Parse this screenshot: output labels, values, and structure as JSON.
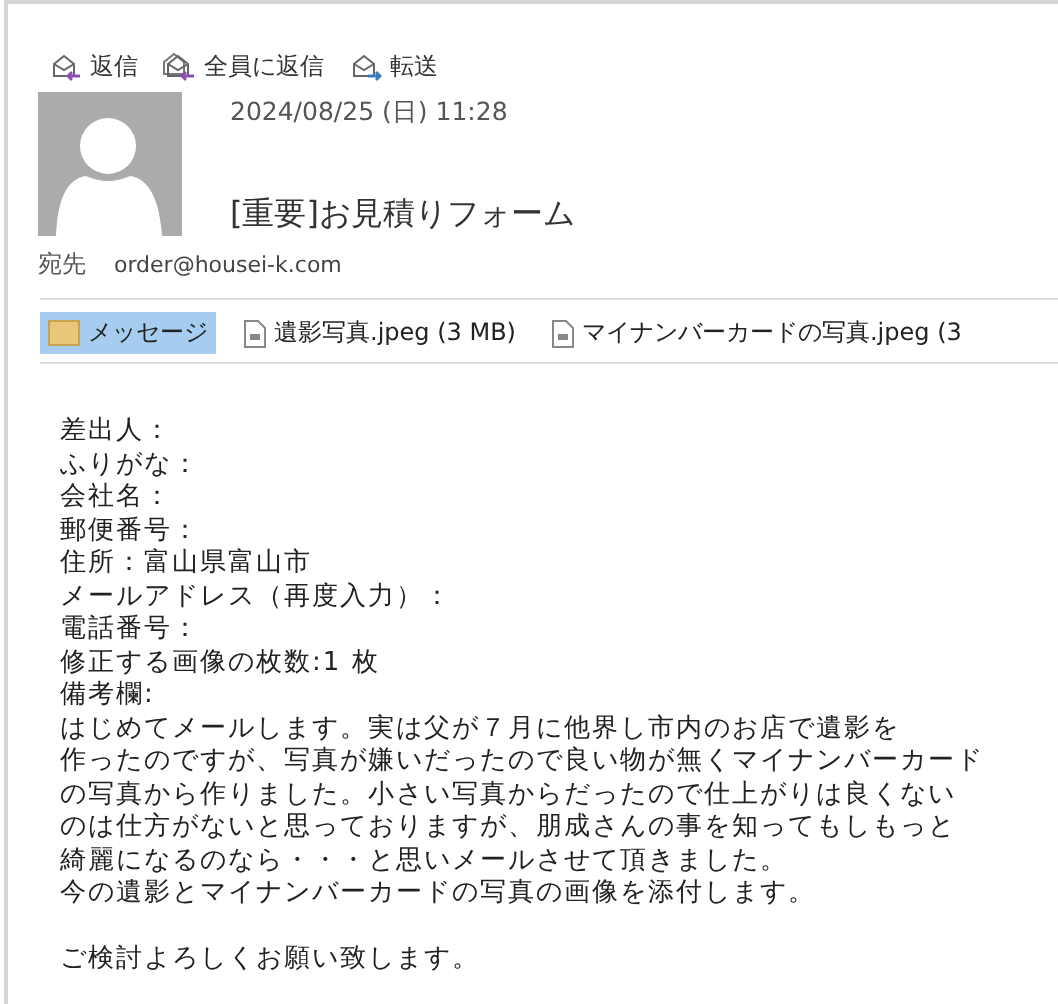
{
  "actions": [
    {
      "label": "返信",
      "kind": "reply"
    },
    {
      "label": "全員に返信",
      "kind": "reply_all"
    },
    {
      "label": "転送",
      "kind": "forward"
    }
  ],
  "message": {
    "date": "2024/08/25 (日) 11:28",
    "subject": "[重要]お見積りフォーム",
    "to_label": "宛先",
    "to": "order@housei-k.com"
  },
  "attachments": [
    {
      "label": "メッセージ",
      "kind": "message",
      "selected": true
    },
    {
      "label": "遺影写真.jpeg (3 MB)",
      "kind": "file",
      "selected": false
    },
    {
      "label": "マイナンバーカードの写真.jpeg (3",
      "kind": "file",
      "selected": false
    }
  ],
  "body": [
    "差出人：",
    "ふりがな：",
    "会社名：",
    "郵便番号：",
    "住所：富山県富山市",
    "メールアドレス（再度入力）：",
    "電話番号：",
    "修正する画像の枚数:1 枚",
    "備考欄:",
    "はじめてメールします。実は父が７月に他界し市内のお店で遺影を",
    "作ったのですが、写真が嫌いだったので良い物が無くマイナンバーカード",
    "の写真から作りました。小さい写真からだったので仕上がりは良くない",
    "のは仕方がないと思っておりますが、朋成さんの事を知ってもしもっと",
    "綺麗になるのなら・・・と思いメールさせて頂きました。",
    "今の遺影とマイナンバーカードの写真の画像を添付します。"
  ],
  "closing": "ご検討よろしくお願い致します。"
}
